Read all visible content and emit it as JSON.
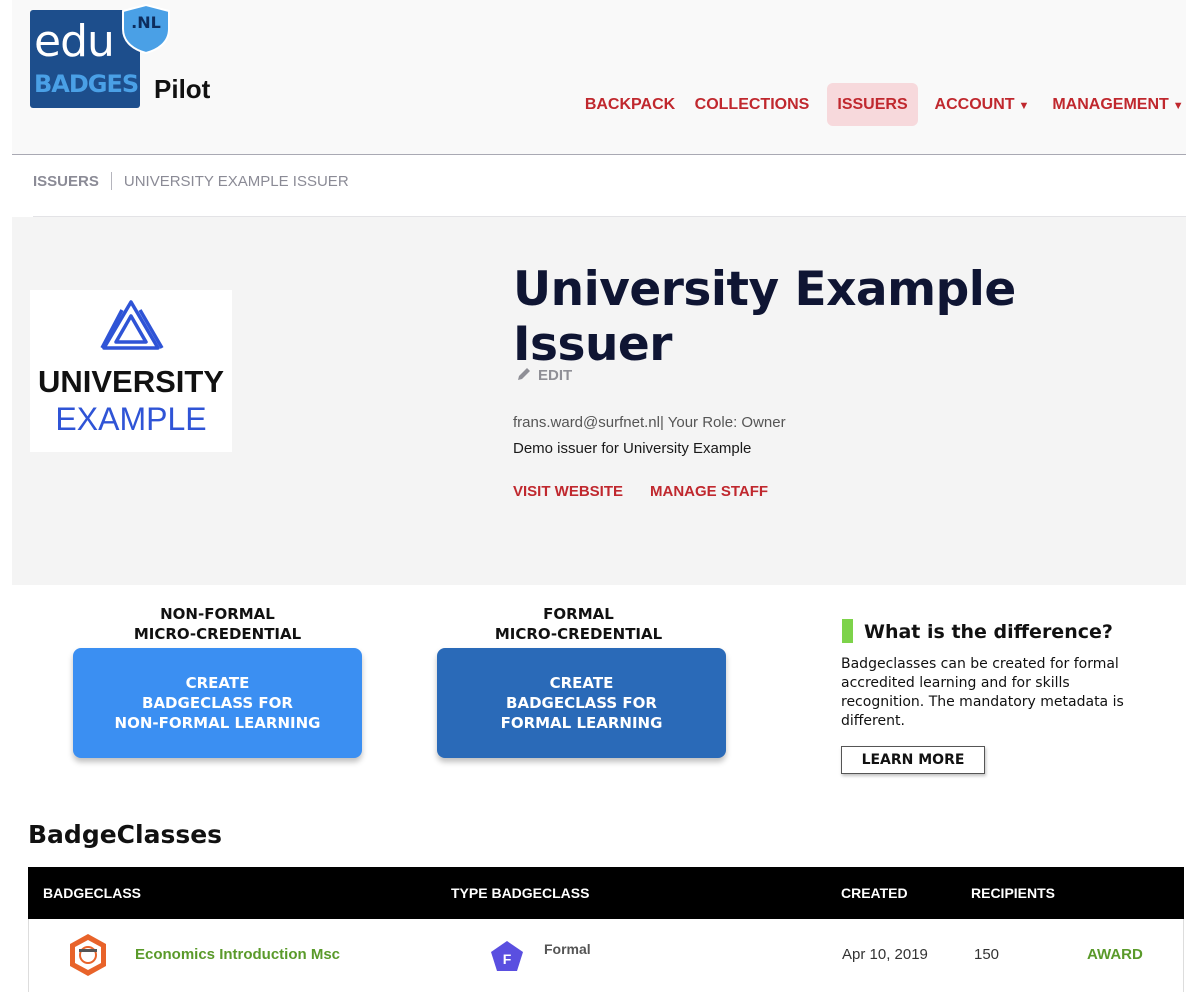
{
  "header": {
    "logo": {
      "top_text": "edu",
      "bottom_text": "BADGES",
      "shield_text": ".NL"
    },
    "pilot_label": "Pilot",
    "nav": [
      {
        "label": "BACKPACK",
        "dropdown": false,
        "active": false
      },
      {
        "label": "COLLECTIONS",
        "dropdown": false,
        "active": false
      },
      {
        "label": "ISSUERS",
        "dropdown": false,
        "active": true
      },
      {
        "label": "ACCOUNT",
        "dropdown": true,
        "active": false
      },
      {
        "label": "MANAGEMENT",
        "dropdown": true,
        "active": false
      }
    ],
    "caret": "▼"
  },
  "breadcrumb": {
    "root": "ISSUERS",
    "current": "UNIVERSITY EXAMPLE ISSUER"
  },
  "issuer": {
    "logo_line1": "UNIVERSITY",
    "logo_line2": "EXAMPLE",
    "title": "University Example Issuer",
    "edit_label": "EDIT",
    "email_role": "frans.ward@surfnet.nl| Your Role: Owner",
    "description": "Demo issuer for University Example",
    "visit_website": "VISIT WEBSITE",
    "manage_staff": "MANAGE STAFF"
  },
  "create": {
    "nonformal_label_1": "NON-FORMAL",
    "nonformal_label_2": "MICRO-CREDENTIAL",
    "nonformal_btn_1": "CREATE",
    "nonformal_btn_2": "BADGECLASS FOR",
    "nonformal_btn_3": "NON-FORMAL LEARNING",
    "formal_label_1": "FORMAL",
    "formal_label_2": "MICRO-CREDENTIAL",
    "formal_btn_1": "CREATE",
    "formal_btn_2": "BADGECLASS FOR",
    "formal_btn_3": "FORMAL LEARNING",
    "difference_title": "What is the difference?",
    "difference_text": "Badgeclasses can be created for formal accredited learning and for skills recognition. The mandatory metadata is different.",
    "learn_more": "LEARN MORE"
  },
  "badgeclasses": {
    "title": "BadgeClasses",
    "columns": [
      "BADGECLASS",
      "TYPE BADGECLASS",
      "CREATED",
      "RECIPIENTS"
    ],
    "rows": [
      {
        "name": "Economics Introduction Msc",
        "type_letter": "F",
        "type": "Formal",
        "created": "Apr 10, 2019",
        "recipients": "150",
        "action": "AWARD"
      }
    ]
  },
  "colors": {
    "brand_red": "#c0282e",
    "nonformal_blue": "#3b8ff2",
    "formal_blue": "#2a6ab8",
    "award_green": "#5a9a2a",
    "accent_green": "#7dd34a",
    "type_purple": "#5a4fe0"
  }
}
